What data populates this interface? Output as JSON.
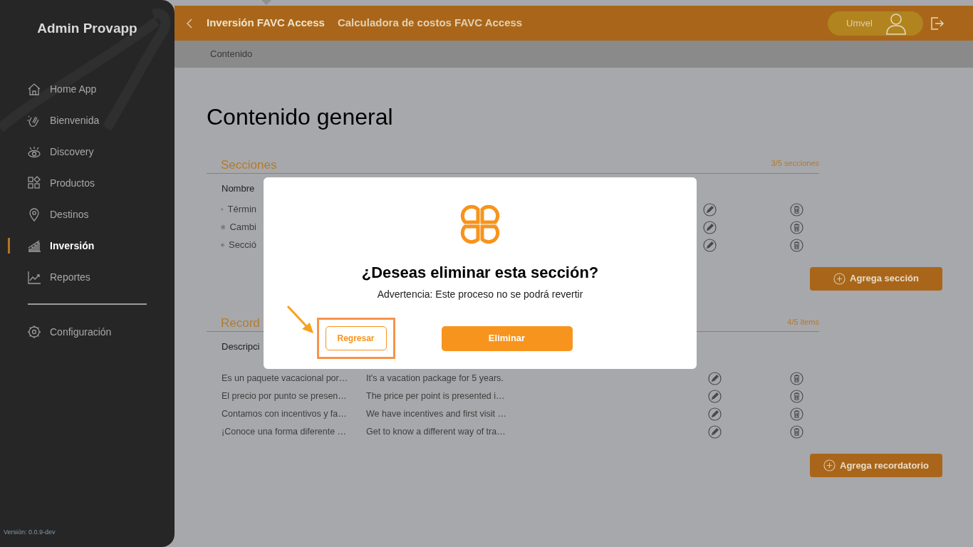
{
  "sidebar": {
    "title": "Admin Provapp",
    "items": [
      {
        "label": "Home App",
        "selected": false
      },
      {
        "label": "Bienvenida",
        "selected": false
      },
      {
        "label": "Discovery",
        "selected": false
      },
      {
        "label": "Productos",
        "selected": false
      },
      {
        "label": "Destinos",
        "selected": false
      },
      {
        "label": "Inversión",
        "selected": true
      },
      {
        "label": "Reportes",
        "selected": false
      }
    ],
    "settings_item": {
      "label": "Configuración",
      "selected": false
    },
    "version": "Versión: 0.0.9-dev"
  },
  "topbar": {
    "tabs": [
      {
        "label": "Inversión FAVC Access",
        "selected": true
      },
      {
        "label": "Calculadora de costos FAVC Access",
        "selected": false
      }
    ],
    "user": "Umvel"
  },
  "breadcrumb": "Contenido",
  "page_title": "Contenido general",
  "sections": {
    "title": "Secciones",
    "count": "3/5 secciones",
    "column": "Nombre",
    "rows": [
      "Términ",
      "Cambi",
      "Secció"
    ],
    "add_button": "Agrega sección"
  },
  "reminders": {
    "title": "Record",
    "count": "4/5 items",
    "column": "Descripci",
    "rows": [
      {
        "spanish": "Es un paquete vacacional por…",
        "english": "It's a vacation package for 5 years."
      },
      {
        "spanish": "El precio por punto se presen…",
        "english": "The price per point is presented i…"
      },
      {
        "spanish": "Contamos con incentivos y fa…",
        "english": "We have incentives and first visit …"
      },
      {
        "spanish": "¡Conoce una forma diferente …",
        "english": "Get to know a different way of tra…"
      }
    ],
    "add_button": "Agrega recordatorio"
  },
  "dialog": {
    "title": "¿Deseas eliminar esta sección?",
    "message": "Advertencia: Este proceso no se podrá revertir",
    "cancel": "Regresar",
    "confirm": "Eliminar"
  }
}
